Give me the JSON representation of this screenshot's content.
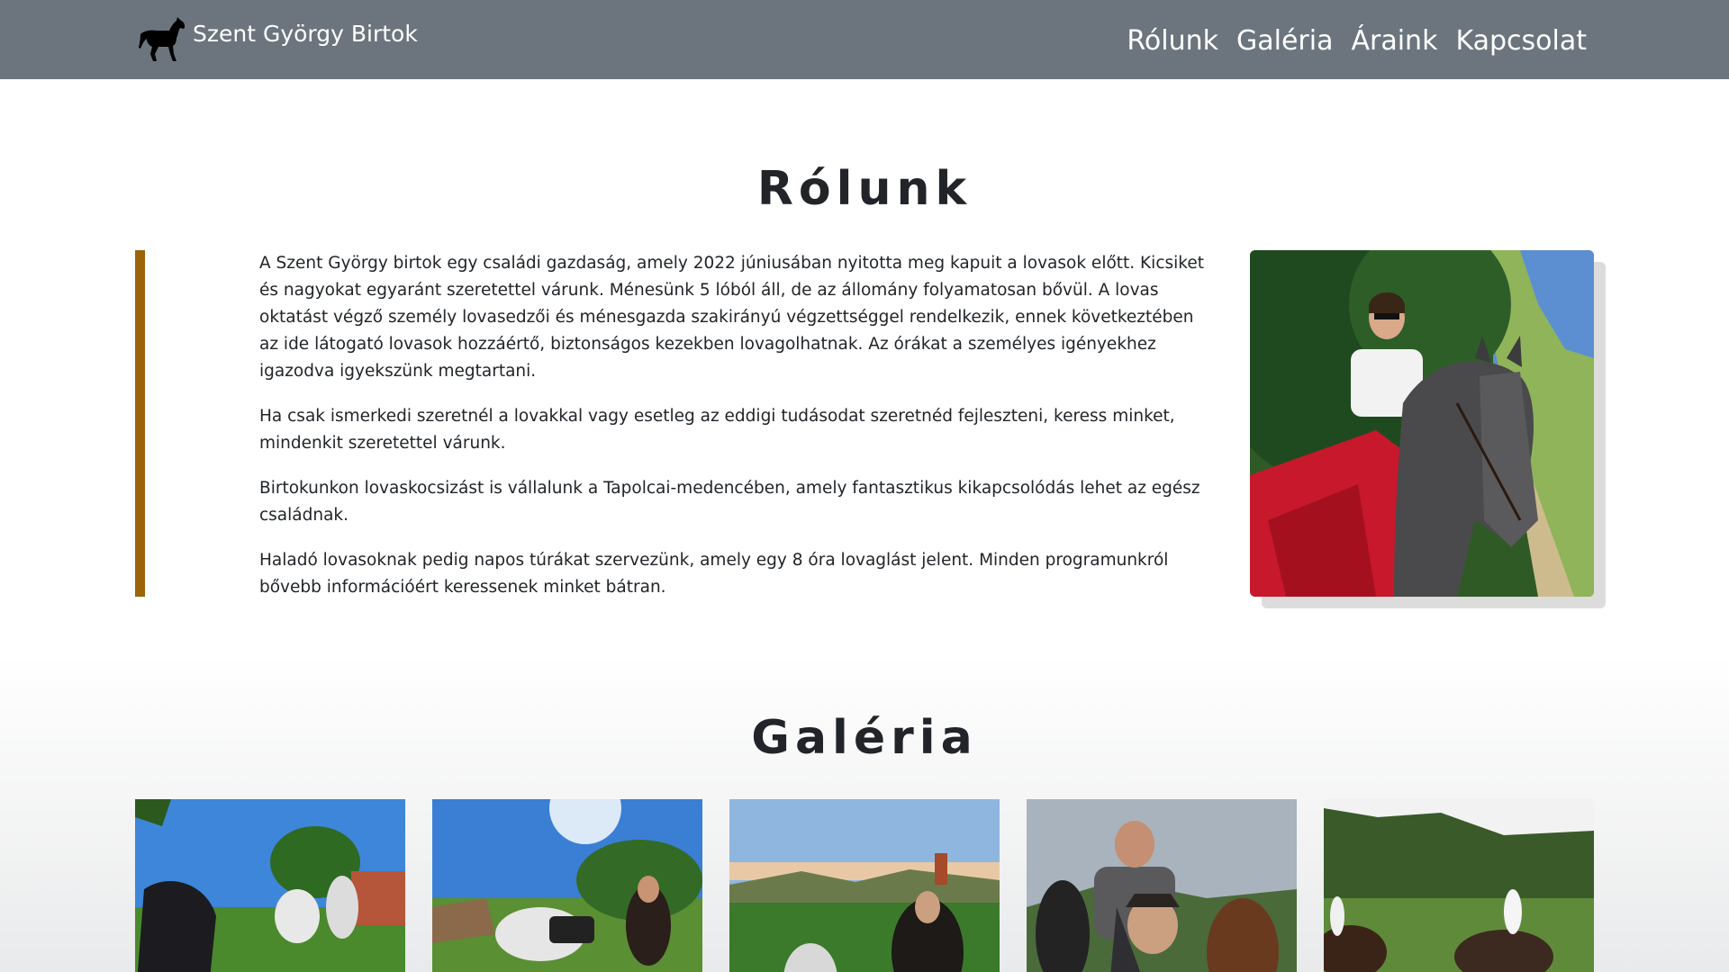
{
  "navbar": {
    "brand_icon": "horse-icon",
    "brand_text": "Szent György Birtok",
    "links": [
      "Rólunk",
      "Galéria",
      "Áraink",
      "Kapcsolat"
    ],
    "background": "#6c757d"
  },
  "about": {
    "title": "Rólunk",
    "accent_color": "#9c6408",
    "paragraphs": [
      "A Szent György birtok egy családi gazdaság, amely 2022 júniusában nyitotta meg kapuit a lovasok előtt. Kicsiket és nagyokat egyaránt szeretettel várunk. Ménesünk 5 lóból áll, de az állomány folyamatosan bővül. A lovas oktatást végző személy lovasedzői és ménesgazda szakirányú végzettséggel rendelkezik, ennek következtében az ide látogató lovasok hozzáértő, biztonságos kezekben lovagolhatnak. Az órákat a személyes igényekhez igazodva igyekszünk megtartani.",
      "Ha csak ismerkedi szeretnél a lovakkal vagy esetleg az eddigi tudásodat szeretnéd fejleszteni, keress minket, mindenkit szeretettel várunk.",
      "Birtokunkon lovaskocsizást is vállalunk a Tapolcai-medencében, amely fantasztikus kikapcsolódás lehet az egész családnak.",
      "Haladó lovasoknak pedig napos túrákat szervezünk, amely egy 8 óra lovaglást jelent. Minden programunkról bővebb információért keressenek minket bátran."
    ]
  },
  "gallery": {
    "title": "Galéria",
    "item_count": 5
  }
}
